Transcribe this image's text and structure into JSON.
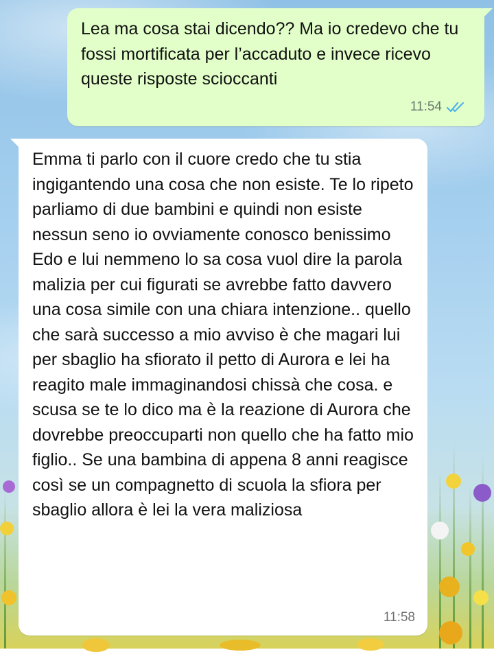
{
  "chat": {
    "messages": [
      {
        "direction": "outgoing",
        "text": "Lea ma cosa stai dicendo?? Ma io credevo che tu fossi mortificata per l’accaduto e invece ricevo queste risposte scioccanti",
        "time": "11:54",
        "status_icon": "double-check-read-icon"
      },
      {
        "direction": "incoming",
        "text": "Emma ti parlo con il cuore credo che tu stia ingigantendo una cosa che non esiste. Te lo ripeto parliamo di due bambini e quindi non esiste nessun seno io ovviamente conosco benissimo Edo e lui nemmeno lo sa  cosa vuol dire la parola malizia per cui figurati se avrebbe fatto davvero una cosa simile con una chiara intenzione.. quello che sarà successo a mio avviso è che magari lui per sbaglio ha sfiorato il petto di Aurora e lei ha reagito male immaginandosi chissà che cosa. e scusa se te lo dico ma è la reazione di Aurora che dovrebbe preoccuparti non quello che ha fatto mio figlio.. Se una bambina di appena 8 anni reagisce così se un compagnetto di scuola la sfiora per sbaglio allora è lei la vera maliziosa",
        "time": "11:58"
      }
    ]
  },
  "colors": {
    "outgoing_bubble": "#e2ffc9",
    "incoming_bubble": "#ffffff",
    "read_ticks": "#4fb3e8",
    "timestamp": "#6a7a70"
  }
}
